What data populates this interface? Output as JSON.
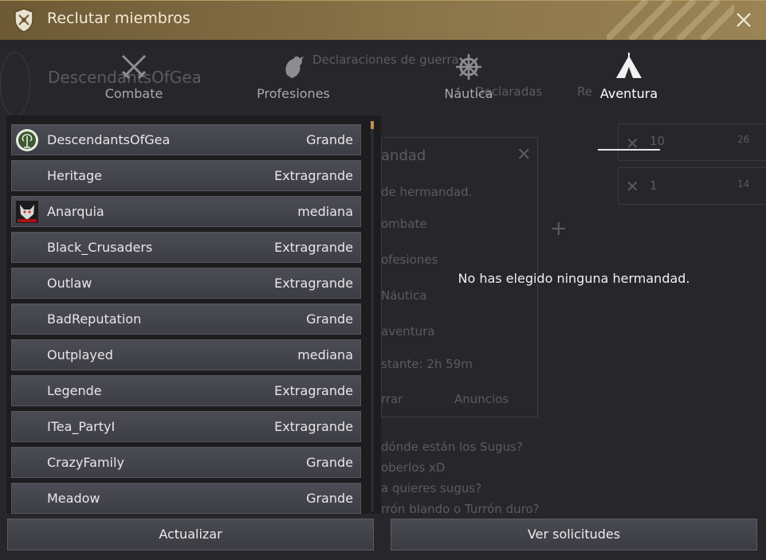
{
  "window": {
    "title": "Reclutar miembros"
  },
  "tabs": [
    {
      "label": "Combate",
      "icon": "crossed-swords-icon"
    },
    {
      "label": "Profesiones",
      "icon": "rooster-icon"
    },
    {
      "label": "Náutica",
      "icon": "ship-wheel-icon"
    },
    {
      "label": "Aventura",
      "icon": "tent-icon"
    }
  ],
  "active_tab": "Aventura",
  "guilds": [
    {
      "name": "DescendantsOfGea",
      "size": "Grande",
      "logo": "tree-emblem"
    },
    {
      "name": "Heritage",
      "size": "Extragrande"
    },
    {
      "name": "Anarquia",
      "size": "mediana",
      "logo": "wolf-emblem"
    },
    {
      "name": "Black_Crusaders",
      "size": "Extragrande"
    },
    {
      "name": "Outlaw",
      "size": "Extragrande"
    },
    {
      "name": "BadReputation",
      "size": "Grande"
    },
    {
      "name": "Outplayed",
      "size": "mediana"
    },
    {
      "name": "Legende",
      "size": "Extragrande"
    },
    {
      "name": "ITea_PartyI",
      "size": "Extragrande"
    },
    {
      "name": "CrazyFamily",
      "size": "Grande"
    },
    {
      "name": "Meadow",
      "size": "Grande"
    }
  ],
  "empty_message": "No has elegido ninguna hermandad.",
  "buttons": {
    "refresh": "Actualizar",
    "view_requests": "Ver solicitudes"
  },
  "background": {
    "guild_name": "DescendantsOfGea",
    "war": "Declaraciones de guerra",
    "declared": "Declaradas",
    "received": "Re",
    "panel_title": "andad",
    "panel_sub": "de hermandad.",
    "opt1": "ombate",
    "opt2": "ofesiones",
    "opt3": "Náutica",
    "opt4": "aventura",
    "remaining": "stante: 2h 59m",
    "btn_a": "rrar",
    "btn_b": "Anuncios",
    "chat1": "dónde están los Sugus?",
    "chat2": "oberlos xD",
    "chat3": "a quieres sugus?",
    "chat4": "rrón blando o Turrón duro?",
    "num1": "10",
    "num2": "26",
    "num3": "1",
    "num4": "14"
  },
  "colors": {
    "titlebar": "#8a7449",
    "accent": "#c98b4a",
    "row": "#45454d"
  }
}
